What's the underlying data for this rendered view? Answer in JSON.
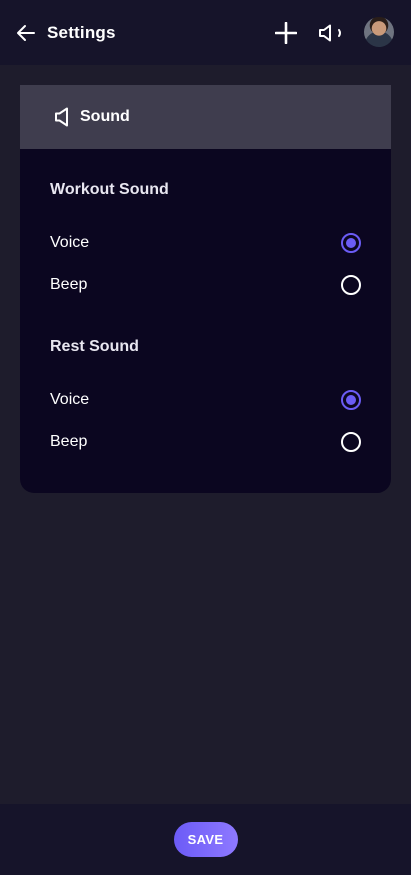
{
  "header": {
    "title": "Settings",
    "back_icon": "arrow-left-icon",
    "add_icon": "plus-icon",
    "sound_icon": "speaker-icon",
    "avatar_icon": "user-avatar"
  },
  "card": {
    "title": "Sound",
    "header_icon": "speaker-icon",
    "sections": [
      {
        "title": "Workout Sound",
        "options": [
          {
            "label": "Voice",
            "selected": true
          },
          {
            "label": "Beep",
            "selected": false
          }
        ]
      },
      {
        "title": "Rest Sound",
        "options": [
          {
            "label": "Voice",
            "selected": true
          },
          {
            "label": "Beep",
            "selected": false
          }
        ]
      }
    ]
  },
  "footer": {
    "save_label": "SAVE"
  },
  "colors": {
    "accent": "#6b5cf5",
    "background": "#1e1c2c",
    "bar": "#16142a",
    "card": "#0b0620",
    "card_header": "#3f3d4e"
  }
}
